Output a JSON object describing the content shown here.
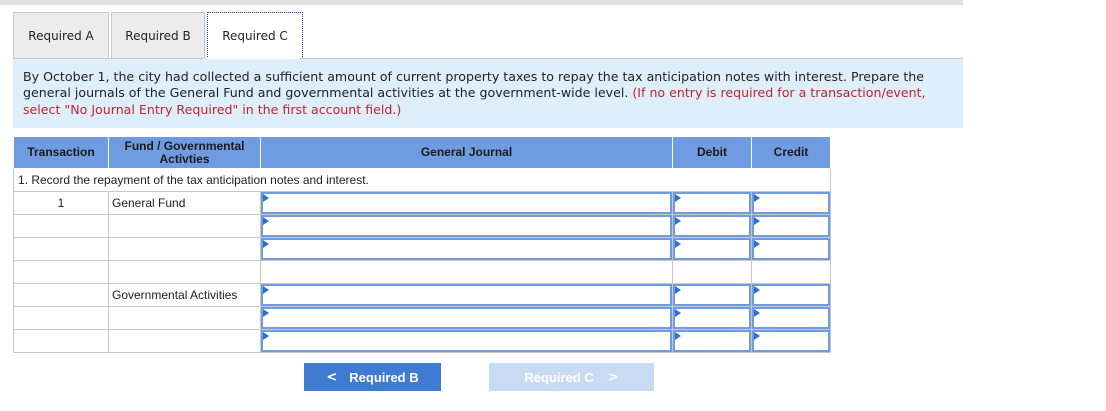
{
  "tabs": [
    {
      "label": "Required A"
    },
    {
      "label": "Required B"
    },
    {
      "label": "Required C"
    }
  ],
  "instructions": {
    "text": "By October 1, the city had collected a sufficient amount of current property taxes to repay the tax anticipation notes with interest. Prepare the general journals of the General Fund and governmental activities at the government-wide level.",
    "note": "(If no entry is required for a transaction/event, select \"No Journal Entry Required\" in the first account field.)"
  },
  "table": {
    "headers": {
      "transaction": "Transaction",
      "fund": "Fund / Governmental Activties",
      "journal": "General Journal",
      "debit": "Debit",
      "credit": "Credit"
    },
    "description": "1. Record the repayment of the tax anticipation notes and interest.",
    "rows": [
      {
        "transaction": "1",
        "fund": "General Fund"
      },
      {
        "transaction": "",
        "fund": ""
      },
      {
        "transaction": "",
        "fund": ""
      },
      {
        "transaction": "",
        "fund": ""
      },
      {
        "transaction": "",
        "fund": "Governmental Activities"
      },
      {
        "transaction": "",
        "fund": ""
      },
      {
        "transaction": "",
        "fund": ""
      }
    ]
  },
  "nav": {
    "prev_label": "Required B",
    "next_label": "Required C",
    "prev_chevron": "<",
    "next_chevron": ">"
  },
  "colors": {
    "header_blue": "#6f9be0",
    "instruction_bg": "#dfeefb",
    "note_red": "#c4232b",
    "button_blue": "#3f7bd1"
  }
}
